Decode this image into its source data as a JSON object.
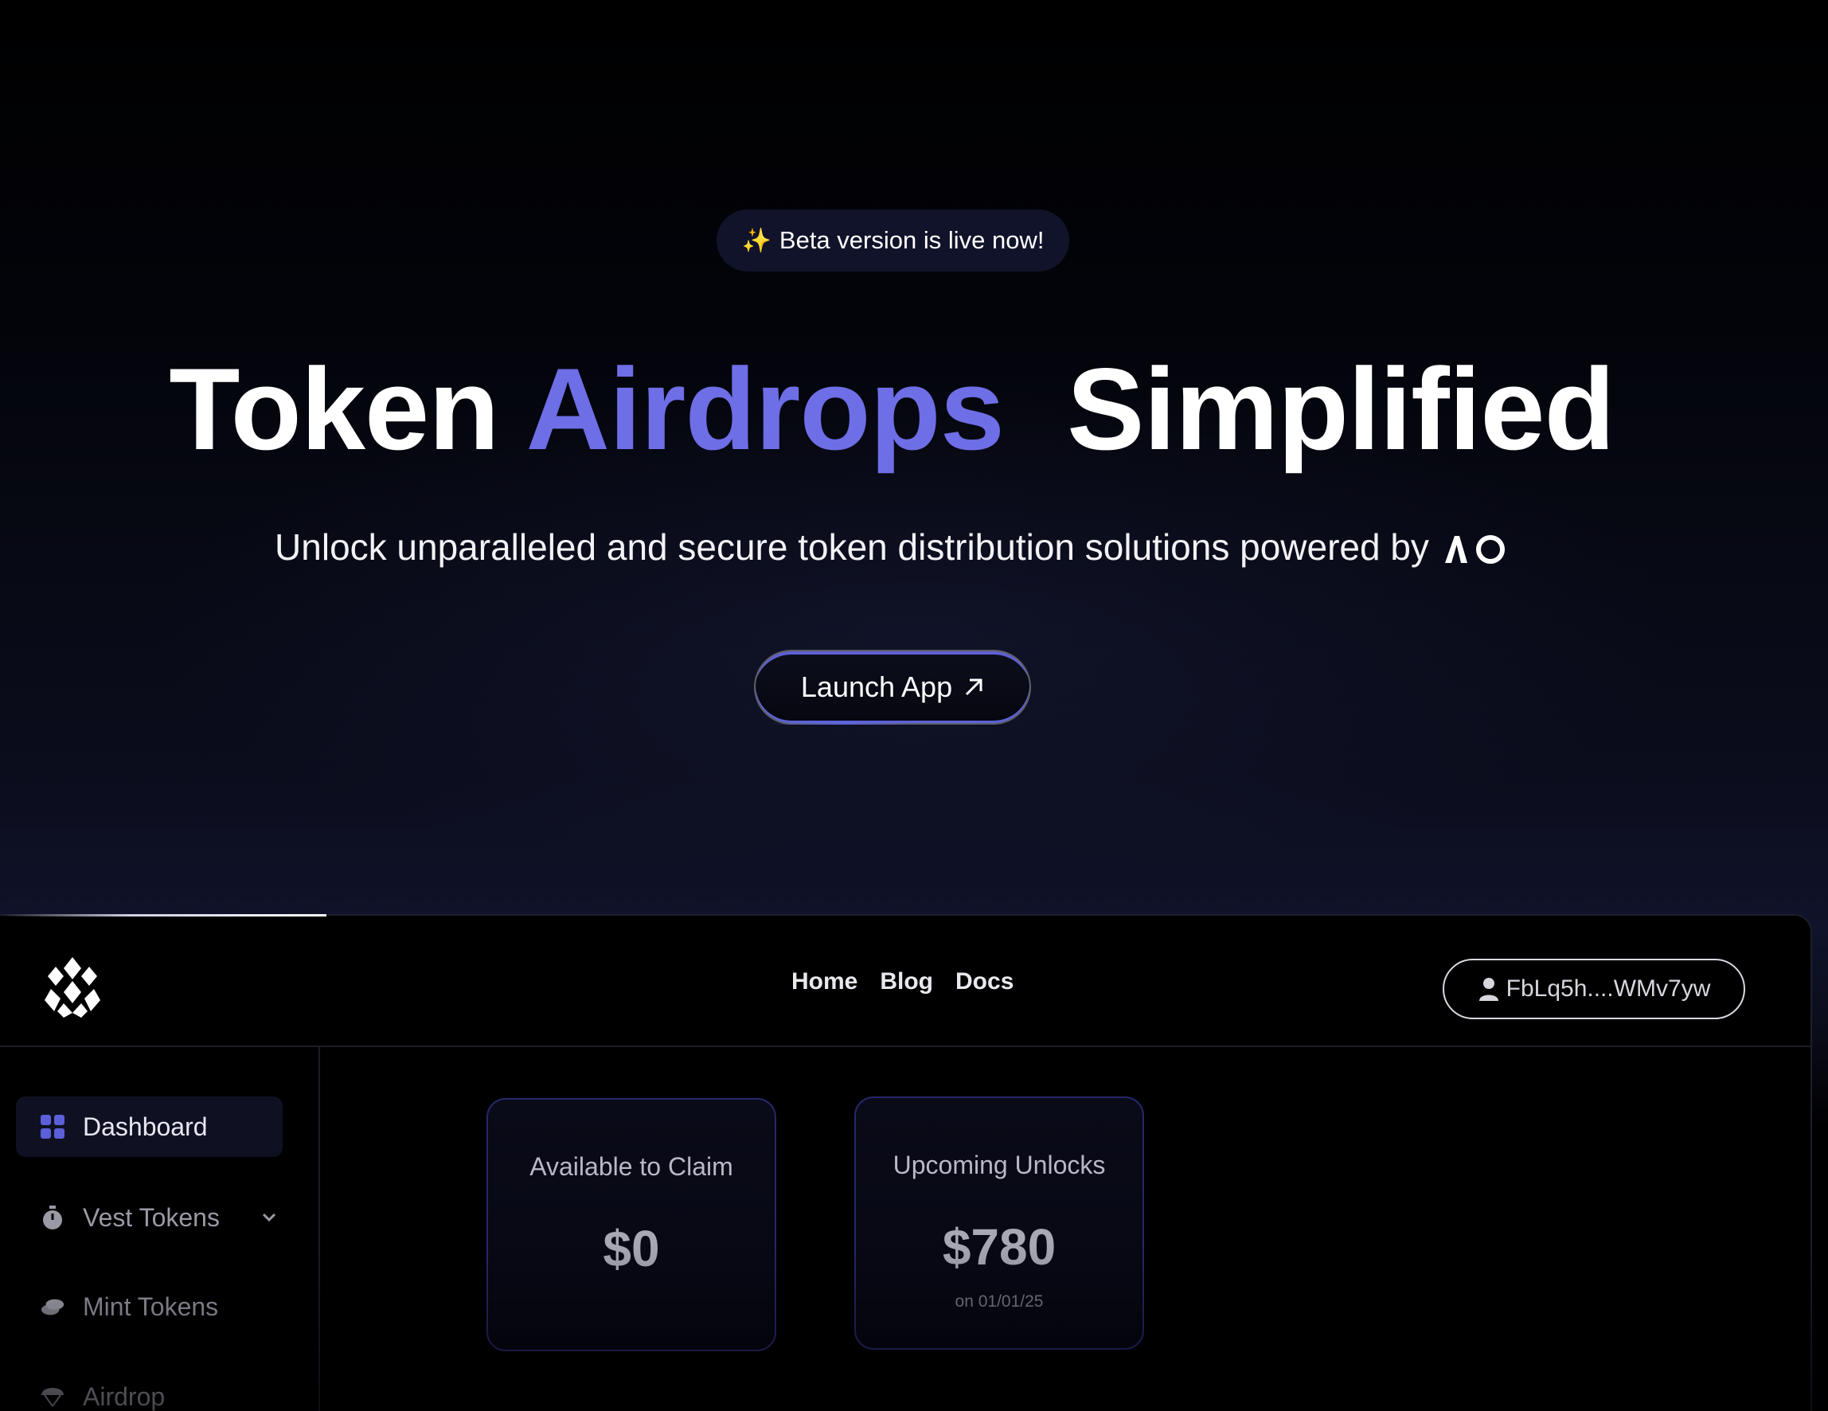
{
  "hero": {
    "badge_icon": "sparkles-icon",
    "badge_text": "Beta version is live now!",
    "title_part1": "Token",
    "title_accent": "Airdrops",
    "title_part2": "Simplified",
    "accent_color": "#6e6ee6",
    "subtitle": "Unlock unparalleled and secure token distribution solutions powered by",
    "powered_by_logo": "ao-logo",
    "cta_label": "Launch App",
    "cta_icon": "arrow-up-right-icon"
  },
  "app": {
    "nav": {
      "home": "Home",
      "blog": "Blog",
      "docs": "Docs"
    },
    "wallet": {
      "icon": "user-icon",
      "address": "FbLq5h....WMv7yw"
    },
    "sidebar": {
      "items": [
        {
          "label": "Dashboard",
          "icon": "grid-icon",
          "active": true
        },
        {
          "label": "Vest Tokens",
          "icon": "stopwatch-icon",
          "has_dropdown": true
        },
        {
          "label": "Mint Tokens",
          "icon": "coins-icon"
        },
        {
          "label": "Airdrop",
          "icon": "parachute-icon"
        }
      ]
    },
    "cards": [
      {
        "title": "Available to Claim",
        "value": "$0",
        "sub": ""
      },
      {
        "title": "Upcoming Unlocks",
        "value": "$780",
        "sub": "on 01/01/25"
      }
    ]
  }
}
